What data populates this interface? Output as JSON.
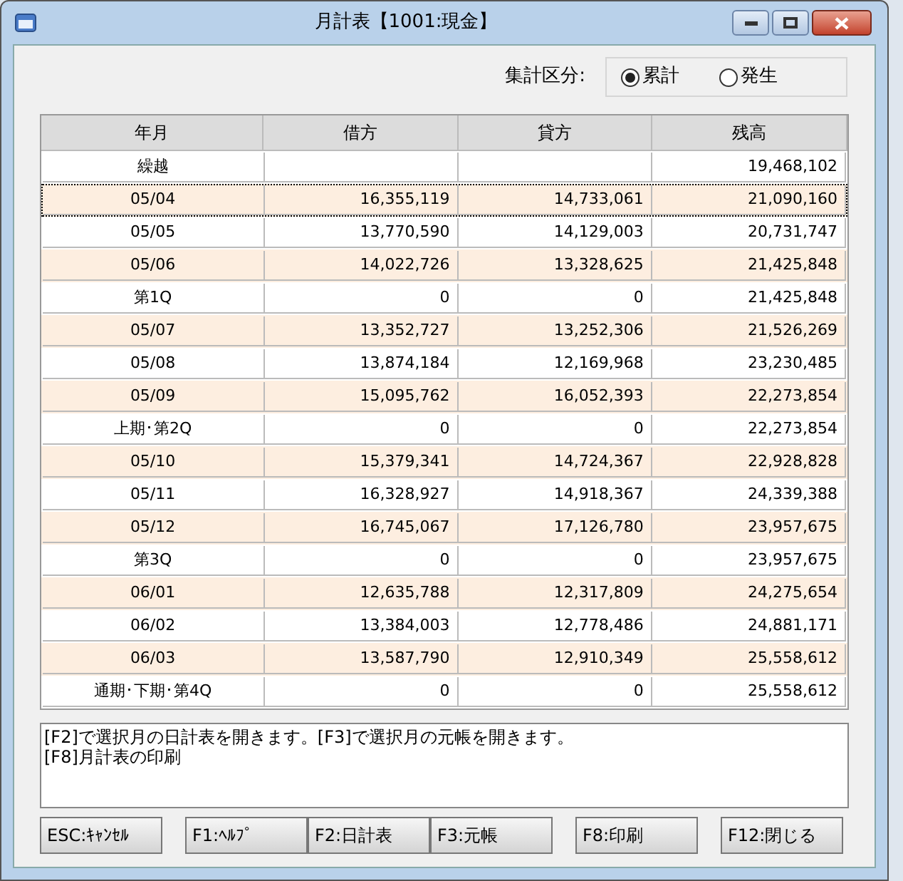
{
  "window": {
    "title": "月計表【1001:現金】"
  },
  "aggregation": {
    "label": "集計区分:",
    "options": [
      {
        "label": "累計",
        "selected": true
      },
      {
        "label": "発生",
        "selected": false
      }
    ]
  },
  "table": {
    "columns": [
      "年月",
      "借方",
      "貸方",
      "残高"
    ],
    "rows": [
      {
        "cells": [
          "繰越",
          "",
          "",
          "19,468,102"
        ],
        "selected": false
      },
      {
        "cells": [
          "05/04",
          "16,355,119",
          "14,733,061",
          "21,090,160"
        ],
        "selected": true
      },
      {
        "cells": [
          "05/05",
          "13,770,590",
          "14,129,003",
          "20,731,747"
        ],
        "selected": false
      },
      {
        "cells": [
          "05/06",
          "14,022,726",
          "13,328,625",
          "21,425,848"
        ],
        "selected": false
      },
      {
        "cells": [
          "第1Q",
          "0",
          "0",
          "21,425,848"
        ],
        "selected": false
      },
      {
        "cells": [
          "05/07",
          "13,352,727",
          "13,252,306",
          "21,526,269"
        ],
        "selected": false
      },
      {
        "cells": [
          "05/08",
          "13,874,184",
          "12,169,968",
          "23,230,485"
        ],
        "selected": false
      },
      {
        "cells": [
          "05/09",
          "15,095,762",
          "16,052,393",
          "22,273,854"
        ],
        "selected": false
      },
      {
        "cells": [
          "上期･第2Q",
          "0",
          "0",
          "22,273,854"
        ],
        "selected": false
      },
      {
        "cells": [
          "05/10",
          "15,379,341",
          "14,724,367",
          "22,928,828"
        ],
        "selected": false
      },
      {
        "cells": [
          "05/11",
          "16,328,927",
          "14,918,367",
          "24,339,388"
        ],
        "selected": false
      },
      {
        "cells": [
          "05/12",
          "16,745,067",
          "17,126,780",
          "23,957,675"
        ],
        "selected": false
      },
      {
        "cells": [
          "第3Q",
          "0",
          "0",
          "23,957,675"
        ],
        "selected": false
      },
      {
        "cells": [
          "06/01",
          "12,635,788",
          "12,317,809",
          "24,275,654"
        ],
        "selected": false
      },
      {
        "cells": [
          "06/02",
          "13,384,003",
          "12,778,486",
          "24,881,171"
        ],
        "selected": false
      },
      {
        "cells": [
          "06/03",
          "13,587,790",
          "12,910,349",
          "25,558,612"
        ],
        "selected": false
      },
      {
        "cells": [
          "通期･下期･第4Q",
          "0",
          "0",
          "25,558,612"
        ],
        "selected": false
      }
    ]
  },
  "help_text": [
    "[F2]で選択月の日計表を開きます。[F3]で選択月の元帳を開きます。",
    "[F8]月計表の印刷"
  ],
  "buttons": [
    "ESC:ｷｬﾝｾﾙ",
    "F1:ﾍﾙﾌﾟ",
    "F2:日計表",
    "F3:元帳",
    "F8:印刷",
    "F12:閉じる"
  ]
}
